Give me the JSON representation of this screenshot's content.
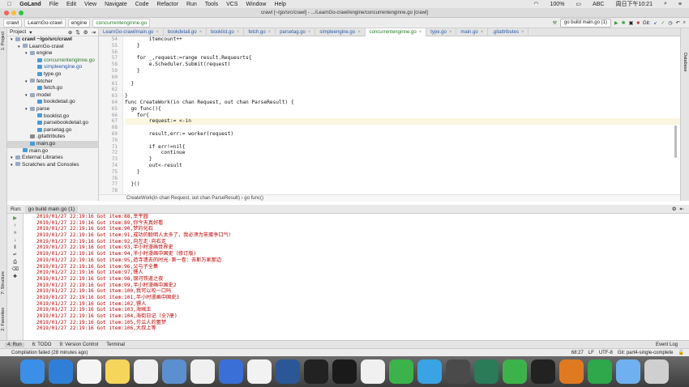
{
  "menubar": {
    "app": "GoLand",
    "items": [
      "File",
      "Edit",
      "View",
      "Navigate",
      "Code",
      "Refactor",
      "Run",
      "Tools",
      "VCS",
      "Window",
      "Help"
    ],
    "status": "100%",
    "input_method": "ABC",
    "clock": "周日下午10:21"
  },
  "window": {
    "title": "crawl [~/go/src/crawl] - .../LearnGo-crawl/engine/concurrentenginne.go [crawl]"
  },
  "navbar": {
    "crumbs": [
      "crawl",
      "LearnGo-crawl",
      "engine",
      "concurrentenginne.go"
    ],
    "run_config": "go build main.go (1)",
    "git_label": "Git:"
  },
  "project": {
    "header": "Project",
    "tree": [
      {
        "label": "crawl ~/go/src/crawl",
        "type": "folder",
        "indent": 0
      },
      {
        "label": "LearnGo-crawl",
        "type": "folder",
        "indent": 1
      },
      {
        "label": "engine",
        "type": "folder",
        "indent": 2
      },
      {
        "label": "concurrentenginne.go",
        "type": "go",
        "indent": 3,
        "color": "#2a7a2a"
      },
      {
        "label": "simpleengine.go",
        "type": "go",
        "indent": 3,
        "color": "#2a5aa8"
      },
      {
        "label": "type.go",
        "type": "go",
        "indent": 3
      },
      {
        "label": "fetcher",
        "type": "folder",
        "indent": 2
      },
      {
        "label": "fetch.go",
        "type": "go",
        "indent": 3
      },
      {
        "label": "model",
        "type": "folder",
        "indent": 2
      },
      {
        "label": "bookdetail.go",
        "type": "go",
        "indent": 3
      },
      {
        "label": "parse",
        "type": "folder",
        "indent": 2
      },
      {
        "label": "booklist.go",
        "type": "go",
        "indent": 3
      },
      {
        "label": "parsebookdetail.go",
        "type": "go",
        "indent": 3
      },
      {
        "label": "parsetag.go",
        "type": "go",
        "indent": 3
      },
      {
        "label": ".gitattributes",
        "type": "git",
        "indent": 2
      },
      {
        "label": "main.go",
        "type": "go",
        "indent": 2,
        "selected": true
      },
      {
        "label": "main.go",
        "type": "go",
        "indent": 1
      },
      {
        "label": "External Libraries",
        "type": "folder",
        "indent": 0
      },
      {
        "label": "Scratches and Consoles",
        "type": "folder",
        "indent": 0
      }
    ]
  },
  "tabs": [
    {
      "label": "LearnGo-crawl/main.go"
    },
    {
      "label": "bookdetail.go"
    },
    {
      "label": "booklist.go"
    },
    {
      "label": "fetch.go"
    },
    {
      "label": "parsetag.go"
    },
    {
      "label": "simpleengine.go"
    },
    {
      "label": "concurrentenginne.go",
      "active": true
    },
    {
      "label": "type.go"
    },
    {
      "label": "main.go"
    },
    {
      "label": ".gitattributes"
    }
  ],
  "editor": {
    "lines": [
      {
        "n": "54",
        "text": "        itemcount++"
      },
      {
        "n": "55",
        "text": "    }"
      },
      {
        "n": "56",
        "text": ""
      },
      {
        "n": "57",
        "text": "    for _,request:=range result.Requesrts{"
      },
      {
        "n": "58",
        "text": "        e.Scheduler.Submit(request)"
      },
      {
        "n": "59",
        "text": "    }"
      },
      {
        "n": "60",
        "text": ""
      },
      {
        "n": "61",
        "text": "  }"
      },
      {
        "n": "62",
        "text": ""
      },
      {
        "n": "63",
        "text": "}"
      },
      {
        "n": "64",
        "text": "func CreateWork(in chan Request, out chan ParseResult) {"
      },
      {
        "n": "65",
        "text": "  go func(){"
      },
      {
        "n": "66",
        "text": "    for{"
      },
      {
        "n": "67",
        "text": "        request:= <-in",
        "current": true
      },
      {
        "n": "68",
        "text": ""
      },
      {
        "n": "69",
        "text": "        result,err:= worker(request)"
      },
      {
        "n": "70",
        "text": ""
      },
      {
        "n": "71",
        "text": "        if err!=nil{"
      },
      {
        "n": "72",
        "text": "            continue"
      },
      {
        "n": "73",
        "text": "        }"
      },
      {
        "n": "74",
        "text": "        out<-result"
      },
      {
        "n": "75",
        "text": "    }"
      },
      {
        "n": "76",
        "text": ""
      },
      {
        "n": "77",
        "text": "  }()"
      },
      {
        "n": "78",
        "text": ""
      }
    ],
    "breadcrumb": "CreateWork(in chan Request, out chan ParseResult)  ›  go func()"
  },
  "run": {
    "label": "Run:",
    "tab": "go build main.go (1)",
    "output": [
      "2019/01/27 22:19:16 Got item:88,幸平园",
      "2019/01/27 22:19:16 Got item:89,你今天真好看",
      "2019/01/27 22:19:16 Got item:90,梦的化石",
      "2019/01/27 22:19:16 Got item:91,成功的聪明人太多了，我必须为笨蛋争口气!",
      "2019/01/27 22:19:16 Got item:92,向左走·向右走",
      "2019/01/27 22:19:16 Got item:93,半小时漫画世界史",
      "2019/01/27 22:19:16 Got item:94,半小时漫画中国史（修订版)",
      "2019/01/27 22:19:16 Got item:95,造寺遗去的时光·第一卷：去斯万家那边",
      "2019/01/27 22:19:16 Got item:96,父与子全集",
      "2019/01/27 22:19:16 Got item:97,镖人",
      "2019/01/27 22:19:16 Got item:98,银河铁道之夜",
      "2019/01/27 22:19:16 Got item:99,半小时漫画中国史2",
      "2019/01/27 22:19:16 Got item:100,我可以咬一口吗",
      "2019/01/27 22:19:16 Got item:101,半小时漫画中国史3",
      "2019/01/27 22:19:16 Got item:102,镖人",
      "2019/01/27 22:19:16 Got item:103,海贼王",
      "2019/01/27 22:19:16 Got item:104,海街日记（全7册)",
      "2019/01/27 22:19:16 Got item:105,芬兰人的噩梦",
      "2019/01/27 22:19:16 Got item:106,大叔上等"
    ]
  },
  "bottom_tabs": {
    "run": "4: Run",
    "todo": "6: TODO",
    "vcs": "9: Version Control",
    "terminal": "Terminal",
    "event_log": "Event Log"
  },
  "status": {
    "message": "Compilation failed (28 minutes ago)",
    "position": "68:27",
    "line_sep": "LF",
    "encoding": "UTF-8",
    "git": "Git: part4-single-complete"
  },
  "left_strip": {
    "project": "1: Project",
    "structure": "7: Structure",
    "favorites": "2: Favorites"
  },
  "right_strip": {
    "database": "Database"
  },
  "dock": [
    "Finder",
    "Safari",
    "27",
    "Notes",
    "Reminders",
    "Preview",
    "Photos",
    "Baidu",
    "Music",
    "Word",
    "GO",
    "GitHub",
    "Chrome",
    "Qt",
    "Telegram",
    "Sublime",
    "Atom",
    "WeChat",
    "Terminal",
    "Transmit",
    "Camtasia",
    "Folder",
    "Trash"
  ]
}
